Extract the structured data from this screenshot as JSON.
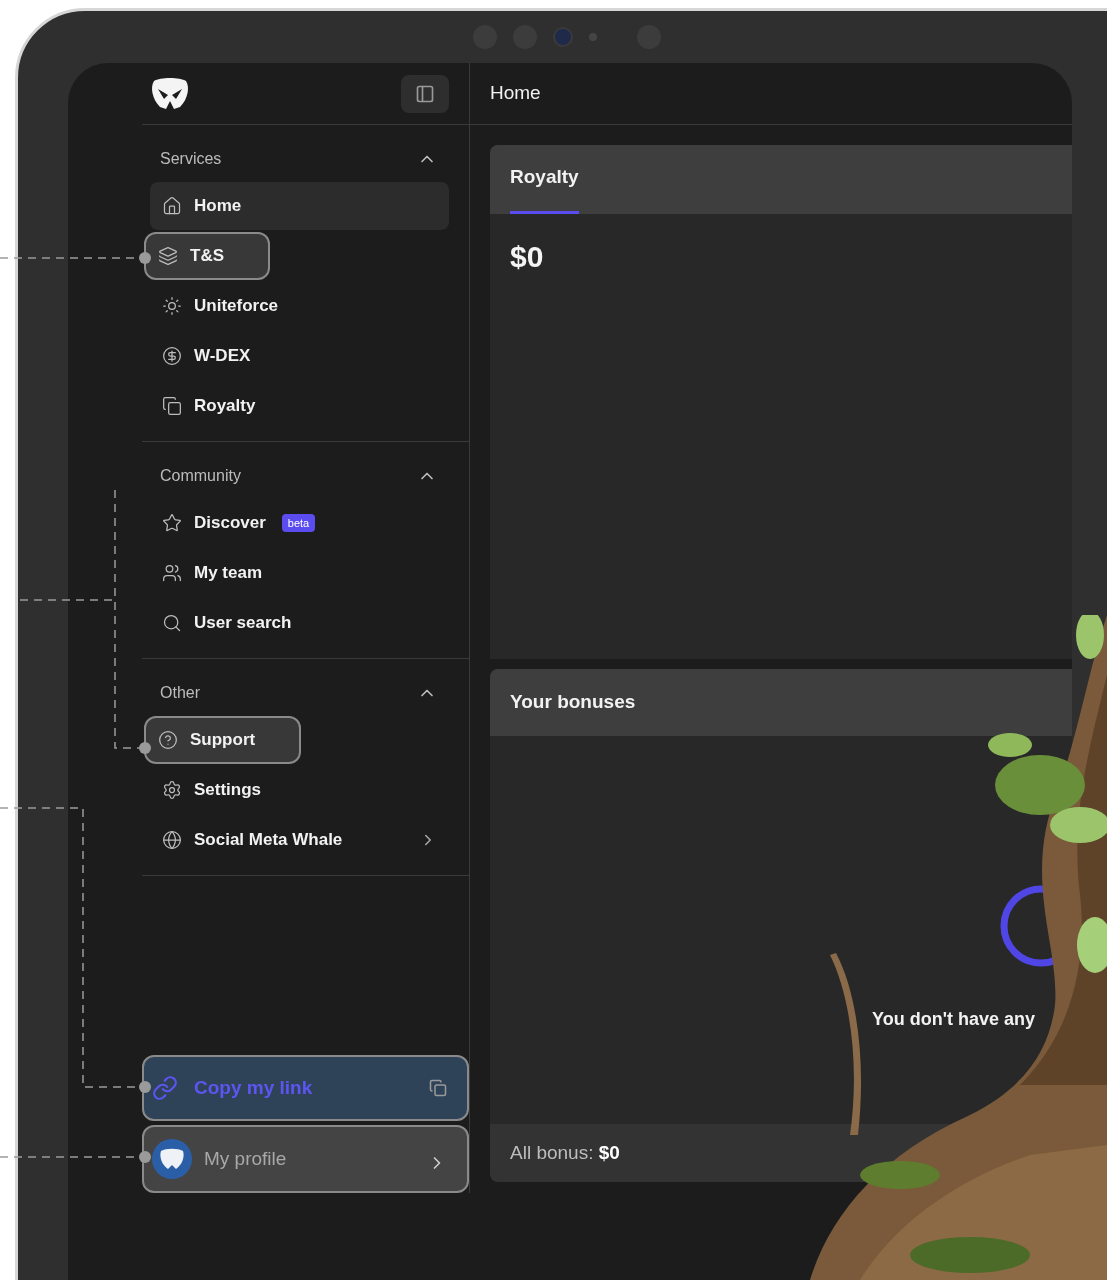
{
  "sidebar": {
    "sections": [
      {
        "title": "Services",
        "expanded": true,
        "items": [
          {
            "label": "Home",
            "selected": true,
            "highlighted": false
          },
          {
            "label": "T&S",
            "selected": false,
            "highlighted": true
          },
          {
            "label": "Uniteforce",
            "selected": false,
            "highlighted": false
          },
          {
            "label": "W-DEX",
            "selected": false,
            "highlighted": false
          },
          {
            "label": "Royalty",
            "selected": false,
            "highlighted": false
          }
        ]
      },
      {
        "title": "Community",
        "expanded": true,
        "items": [
          {
            "label": "Discover",
            "badge": "beta",
            "selected": false,
            "highlighted": false
          },
          {
            "label": "My team",
            "selected": false,
            "highlighted": false
          },
          {
            "label": "User search",
            "selected": false,
            "highlighted": false
          }
        ]
      },
      {
        "title": "Other",
        "expanded": true,
        "items": [
          {
            "label": "Support",
            "selected": false,
            "highlighted": true
          },
          {
            "label": "Settings",
            "selected": false,
            "highlighted": false
          },
          {
            "label": "Social Meta Whale",
            "has_submenu": true,
            "selected": false,
            "highlighted": false
          }
        ]
      }
    ],
    "copy_link": {
      "label": "Copy my link",
      "highlighted": true
    },
    "profile": {
      "label": "My profile",
      "highlighted": true
    }
  },
  "main": {
    "title": "Home",
    "royalty_card": {
      "tabs": [
        {
          "label": "Royalty",
          "selected": true
        }
      ],
      "amount": "$0"
    },
    "bonuses_card": {
      "title": "Your bonuses",
      "empty_message": "You don't have any",
      "total": "All bonus: **$0**"
    }
  }
}
